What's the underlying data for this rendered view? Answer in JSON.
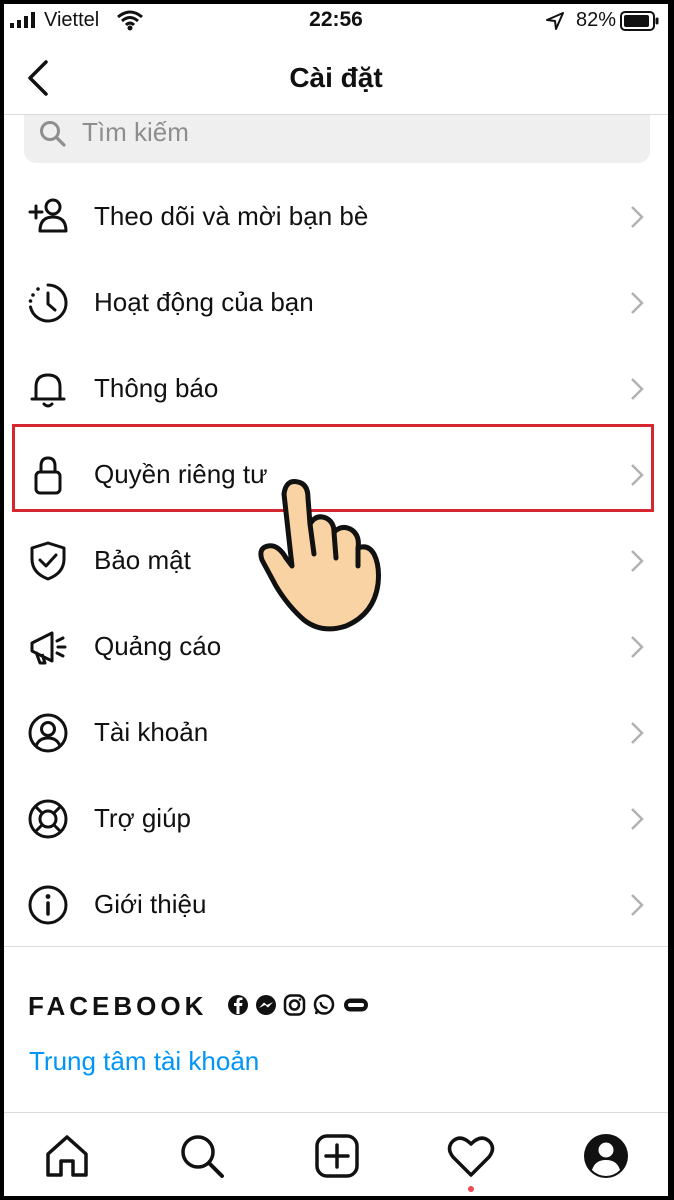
{
  "status_bar": {
    "carrier": "Viettel",
    "time": "22:56",
    "battery": "82%"
  },
  "header": {
    "title": "Cài đặt"
  },
  "search": {
    "placeholder": "Tìm kiếm"
  },
  "menu": [
    {
      "label": "Theo dõi và mời bạn bè",
      "icon": "add-person-icon"
    },
    {
      "label": "Hoạt động của bạn",
      "icon": "activity-clock-icon"
    },
    {
      "label": "Thông báo",
      "icon": "bell-icon"
    },
    {
      "label": "Quyền riêng tư",
      "icon": "lock-icon",
      "highlighted": true
    },
    {
      "label": "Bảo mật",
      "icon": "shield-icon"
    },
    {
      "label": "Quảng cáo",
      "icon": "megaphone-icon"
    },
    {
      "label": "Tài khoản",
      "icon": "account-circle-icon"
    },
    {
      "label": "Trợ giúp",
      "icon": "lifebuoy-icon"
    },
    {
      "label": "Giới thiệu",
      "icon": "info-icon"
    }
  ],
  "facebook": {
    "brand": "FACEBOOK",
    "accounts_center": "Trung tâm tài khoản"
  },
  "tabbar": [
    "home-icon",
    "search-icon",
    "new-post-icon",
    "activity-heart-icon",
    "profile-icon"
  ],
  "colors": {
    "highlight": "#d62630",
    "link": "#0095f6",
    "notification_dot": "#ed4956"
  }
}
